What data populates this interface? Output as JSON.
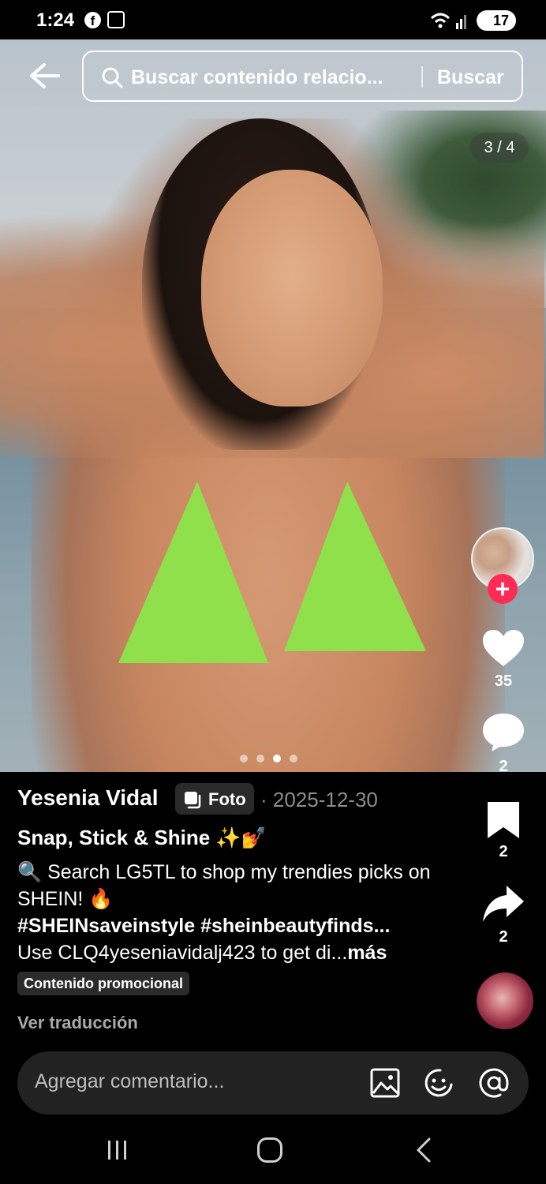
{
  "status_bar": {
    "time": "1:24",
    "facebook_glyph": "f",
    "battery": "17"
  },
  "search": {
    "placeholder": "Buscar contenido relacio...",
    "button": "Buscar"
  },
  "media": {
    "counter": "3 / 4",
    "total_images": 4,
    "current_index": 3
  },
  "actions": {
    "likes": "35",
    "comments": "2",
    "bookmarks": "2",
    "shares": "2"
  },
  "post": {
    "author": "Yesenia Vidal",
    "type_label": "Foto",
    "date": "· 2025-12-30",
    "title": "Snap, Stick & Shine ✨💅",
    "desc_line1": "🔍 Search LG5TL to shop my trendies picks on SHEIN! 🔥",
    "hashtags": "#SHEINsaveinstyle #sheinbeautyfinds...",
    "desc_line3": "Use CLQ4yeseniavidalj423 to get di...",
    "more_label": "más",
    "promo_label": "Contenido promocional",
    "translate_label": "Ver traducción"
  },
  "comment_bar": {
    "placeholder": "Agregar comentario..."
  },
  "colors": {
    "follow_red": "#fe2c55",
    "background": "#000000",
    "secondary_text": "#8e8e8e"
  },
  "icons": [
    "back-arrow-icon",
    "search-icon",
    "heart-icon",
    "comment-icon",
    "bookmark-icon",
    "share-icon",
    "image-icon",
    "emoji-icon",
    "at-icon",
    "photo-stack-icon"
  ]
}
